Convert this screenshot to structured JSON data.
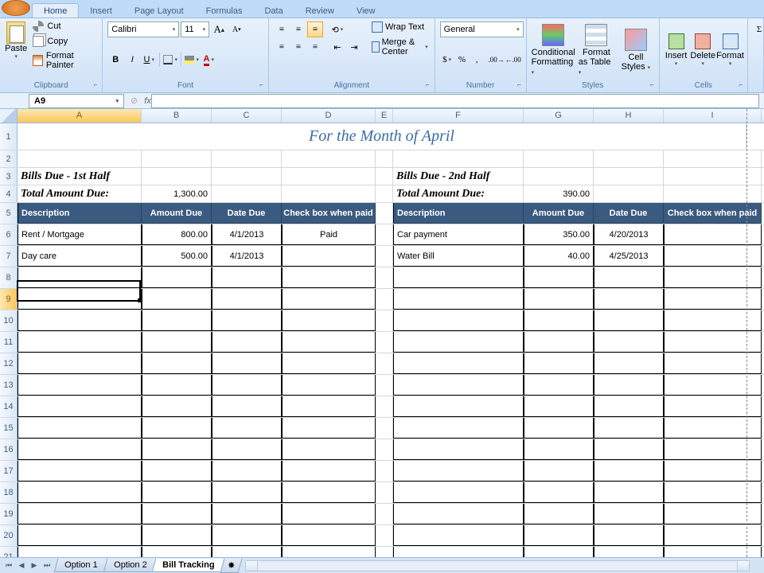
{
  "ribbon": {
    "tabs": [
      "Home",
      "Insert",
      "Page Layout",
      "Formulas",
      "Data",
      "Review",
      "View"
    ],
    "active_tab": "Home",
    "clipboard": {
      "paste": "Paste",
      "cut": "Cut",
      "copy": "Copy",
      "format_painter": "Format Painter",
      "label": "Clipboard"
    },
    "font": {
      "name": "Calibri",
      "size": "11",
      "label": "Font"
    },
    "alignment": {
      "wrap": "Wrap Text",
      "merge": "Merge & Center",
      "label": "Alignment"
    },
    "number": {
      "format": "General",
      "label": "Number"
    },
    "styles": {
      "cond": "Conditional",
      "cond2": "Formatting",
      "fat": "Format",
      "fat2": "as Table",
      "cell": "Cell",
      "cell2": "Styles",
      "label": "Styles"
    },
    "cells": {
      "insert": "Insert",
      "delete": "Delete",
      "format": "Format",
      "label": "Cells"
    }
  },
  "name_box": "A9",
  "fx_label": "fx",
  "columns": [
    "A",
    "B",
    "C",
    "D",
    "E",
    "F",
    "G",
    "H",
    "I"
  ],
  "sheet": {
    "title": "For the Month of April",
    "left": {
      "heading": "Bills Due - 1st Half",
      "total_label": "Total Amount Due:",
      "total": "1,300.00",
      "headers": [
        "Description",
        "Amount Due",
        "Date Due",
        "Check box when paid"
      ],
      "rows": [
        {
          "desc": "Rent / Mortgage",
          "amt": "800.00",
          "date": "4/1/2013",
          "paid": "Paid"
        },
        {
          "desc": "Day care",
          "amt": "500.00",
          "date": "4/1/2013",
          "paid": ""
        }
      ]
    },
    "right": {
      "heading": "Bills Due - 2nd Half",
      "total_label": "Total Amount Due:",
      "total": "390.00",
      "headers": [
        "Description",
        "Amount Due",
        "Date Due",
        "Check box when paid"
      ],
      "rows": [
        {
          "desc": "Car payment",
          "amt": "350.00",
          "date": "4/20/2013",
          "paid": ""
        },
        {
          "desc": "Water Bill",
          "amt": "40.00",
          "date": "4/25/2013",
          "paid": ""
        }
      ]
    }
  },
  "sheet_tabs": [
    "Option 1",
    "Option 2",
    "Bill Tracking"
  ],
  "active_sheet": "Bill Tracking"
}
